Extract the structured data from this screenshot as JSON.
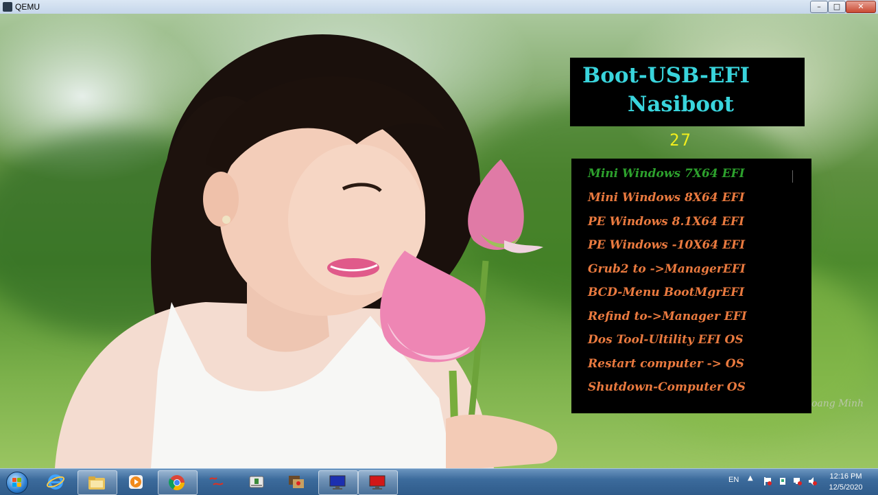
{
  "window": {
    "title": "QEMU",
    "controls": {
      "minimize": "–",
      "maximize": "□",
      "close": "✕"
    }
  },
  "boot_screen": {
    "title_line1": "Boot-USB-EFI",
    "title_line2": "Nasiboot",
    "countdown": "27",
    "menu_items": [
      {
        "label": "Mini Windows 7X64 EFI",
        "selected": true
      },
      {
        "label": "Mini Windows 8X64 EFI",
        "selected": false
      },
      {
        "label": "PE Windows 8.1X64 EFI",
        "selected": false
      },
      {
        "label": "PE Windows -10X64 EFI",
        "selected": false
      },
      {
        "label": "Grub2 to ->ManagerEFI",
        "selected": false
      },
      {
        "label": "BCD-Menu BootMgrEFI",
        "selected": false
      },
      {
        "label": "Refind to->Manager EFI",
        "selected": false
      },
      {
        "label": "Dos Tool-Ultility EFI OS",
        "selected": false
      },
      {
        "label": "Restart computer -> OS",
        "selected": false
      },
      {
        "label": "Shutdown-Computer OS",
        "selected": false
      }
    ],
    "watermark": "oang Minh",
    "colors": {
      "title": "#39d4dc",
      "countdown": "#f2ee1d",
      "item": "#ea7a3f",
      "selected_item": "#2da12d"
    }
  },
  "taskbar": {
    "start": "start-orb-icon",
    "pinned": [
      {
        "name": "ie-icon"
      },
      {
        "name": "folder-icon"
      },
      {
        "name": "media-player-icon"
      },
      {
        "name": "chrome-icon"
      },
      {
        "name": "boot-app-icon"
      },
      {
        "name": "usb-tool-icon"
      },
      {
        "name": "hardware-app-icon"
      },
      {
        "name": "monitor-blue-icon"
      },
      {
        "name": "monitor-red-icon"
      }
    ],
    "tray": {
      "language": "EN",
      "time": "12:16 PM",
      "date": "12/5/2020"
    }
  }
}
